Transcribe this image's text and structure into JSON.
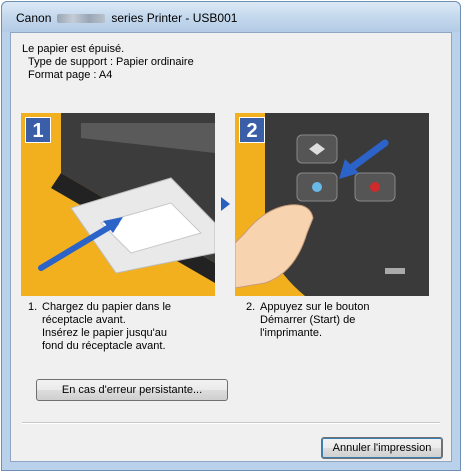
{
  "window": {
    "title_prefix": "Canon",
    "title_suffix": "series Printer - USB001"
  },
  "message": {
    "line1": "Le papier est épuisé.",
    "line2": "Type de support : Papier ordinaire",
    "line3": "Format page : A4"
  },
  "illustrations": [
    {
      "badge": "1"
    },
    {
      "badge": "2"
    }
  ],
  "steps": [
    {
      "number": "1.",
      "text_lines": [
        "Chargez du papier dans le",
        "réceptacle avant.",
        "Insérez le papier jusqu'au",
        "fond du réceptacle avant."
      ]
    },
    {
      "number": "2.",
      "text_lines": [
        "Appuyez sur le bouton",
        "Démarrer (Start) de",
        "l'imprimante."
      ]
    }
  ],
  "buttons": {
    "persistent_error": "En cas d'erreur persistante...",
    "cancel_print": "Annuler l'impression"
  },
  "colors": {
    "illustration_bg": "#f2b01e",
    "badge_bg": "#3a5fa8",
    "arrow": "#2b5fbf"
  }
}
